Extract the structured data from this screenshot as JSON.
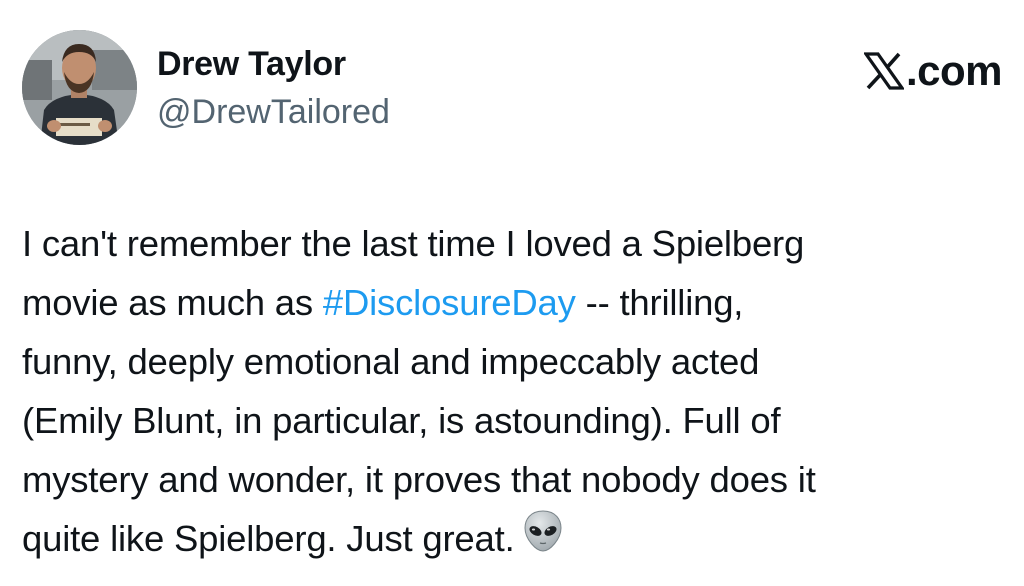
{
  "author": {
    "name": "Drew Taylor",
    "handle": "@DrewTailored",
    "avatar_icon": "profile-photo"
  },
  "site": {
    "logo_icon": "x-logo-icon",
    "text": ".com"
  },
  "tweet": {
    "lines": [
      {
        "text": "I can't remember the last time I loved a Spielberg"
      },
      {
        "pre": "movie as much as ",
        "hashtag": "#DisclosureDay",
        "post": " -- thrilling,"
      },
      {
        "text": "funny, deeply emotional and impeccably acted"
      },
      {
        "text": "(Emily Blunt, in particular, is astounding). Full of"
      },
      {
        "text": "mystery and wonder, it proves that nobody does it"
      },
      {
        "text": "quite like Spielberg. Just great."
      }
    ],
    "trailing_emoji": "alien-icon"
  },
  "colors": {
    "text": "#0f1419",
    "handle": "#536471",
    "hashtag": "#1d9bf0"
  }
}
